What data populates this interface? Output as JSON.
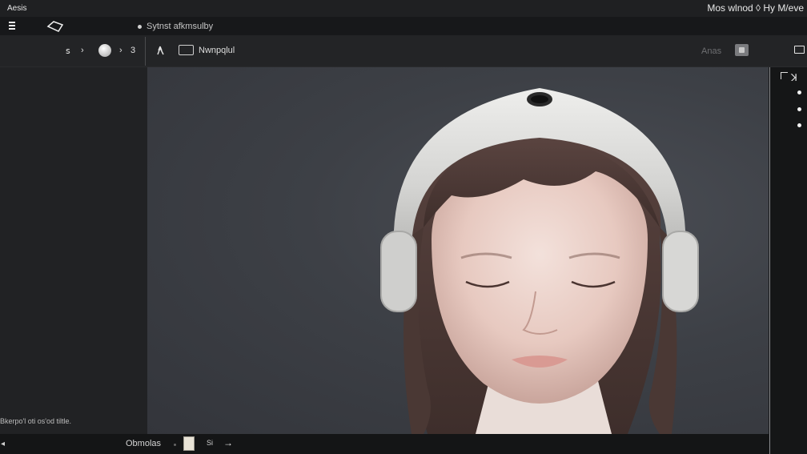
{
  "titlebar": {
    "app_name": "Aesis",
    "right_text": "Mos wlnod ◊ Hy M/eve"
  },
  "menubar": {
    "document_title": "Sytnst afkmsulby"
  },
  "toolbar": {
    "item_1": "ꜱ",
    "item_2": "›",
    "item_3": "›",
    "item_4": "3",
    "item_5": "ꓘ",
    "view_label": "Nwnpqlul",
    "right_label": "Anas"
  },
  "left_panel": {
    "status_text": "Bkerpo'l oti os'od tiltle."
  },
  "right_panel": {
    "header": "ꓘ"
  },
  "bottombar": {
    "label": "Obmolas",
    "page_num": "Si",
    "left_arrow": "◂",
    "right_arrow": "→"
  },
  "colors": {
    "canvas": "#3d4046",
    "panel": "#212224",
    "toolbar": "#232426",
    "titlebar": "#1f2022"
  },
  "icons": [
    "menu-icon",
    "tag-icon",
    "ball-icon",
    "square-icon",
    "panel-icon",
    "person-icon"
  ]
}
